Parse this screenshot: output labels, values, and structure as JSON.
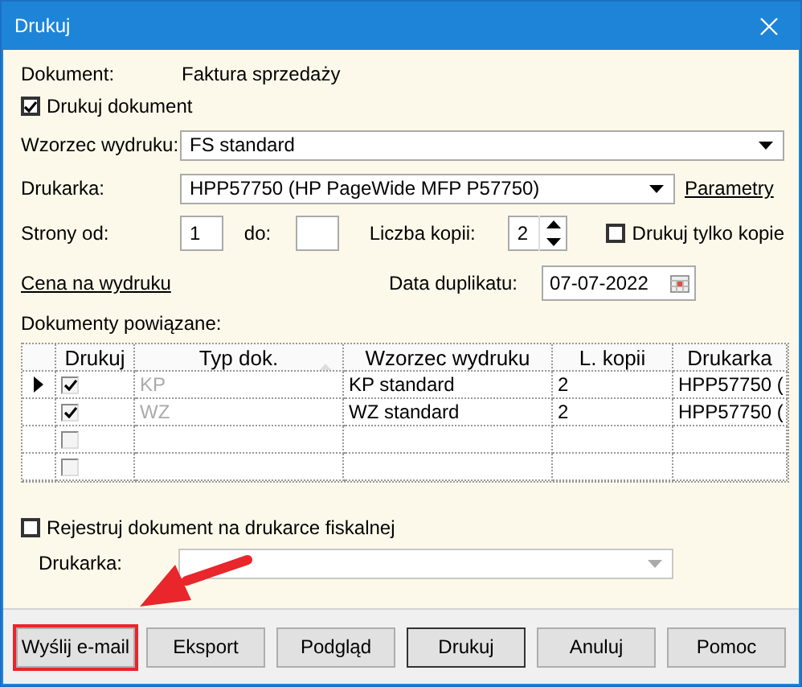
{
  "window": {
    "title": "Drukuj"
  },
  "document": {
    "label": "Dokument:",
    "value": "Faktura sprzedaży"
  },
  "print_document": {
    "label": "Drukuj dokument",
    "checked": true
  },
  "template": {
    "label": "Wzorzec wydruku:",
    "value": "FS standard"
  },
  "printer": {
    "label": "Drukarka:",
    "value": "HPP57750 (HP PageWide MFP P57750)",
    "link": "Parametry"
  },
  "pages": {
    "from_label": "Strony od:",
    "from_value": "1",
    "to_label": "do:"
  },
  "copies": {
    "label": "Liczba kopii:",
    "value": "2"
  },
  "copies_only": {
    "label": "Drukuj tylko kopie",
    "checked": false
  },
  "price_link": "Cena na wydruku",
  "duplicate_date": {
    "label": "Data duplikatu:",
    "value": "07-07-2022"
  },
  "related": {
    "label": "Dokumenty powiązane:",
    "columns": [
      {
        "label": "Drukuj",
        "sorted": false
      },
      {
        "label": "Typ dok.",
        "sorted": true
      },
      {
        "label": "Wzorzec wydruku",
        "sorted": false
      },
      {
        "label": "L. kopii",
        "sorted": false
      },
      {
        "label": "Drukarka",
        "sorted": false
      }
    ],
    "rows": [
      {
        "current": true,
        "print": true,
        "type": "KP",
        "template": "KP standard",
        "copies": "2",
        "printer": "HPP57750 ("
      },
      {
        "current": false,
        "print": true,
        "type": "WZ",
        "template": "WZ standard",
        "copies": "2",
        "printer": "HPP57750 ("
      },
      {
        "current": false,
        "print": false
      },
      {
        "current": false,
        "print": false
      }
    ]
  },
  "fiscal": {
    "label": "Rejestruj dokument na drukarce fiskalnej",
    "checked": false
  },
  "fiscal_printer": {
    "label": "Drukarka:",
    "disabled": true
  },
  "buttons": [
    {
      "label": "Wyślij e-mail",
      "default": false,
      "highlighted": true
    },
    {
      "label": "Eksport",
      "default": false,
      "highlighted": false
    },
    {
      "label": "Podgląd",
      "default": false,
      "highlighted": false
    },
    {
      "label": "Drukuj",
      "default": true,
      "highlighted": false
    },
    {
      "label": "Anuluj",
      "default": false,
      "highlighted": false
    },
    {
      "label": "Pomoc",
      "default": false,
      "highlighted": false
    }
  ]
}
